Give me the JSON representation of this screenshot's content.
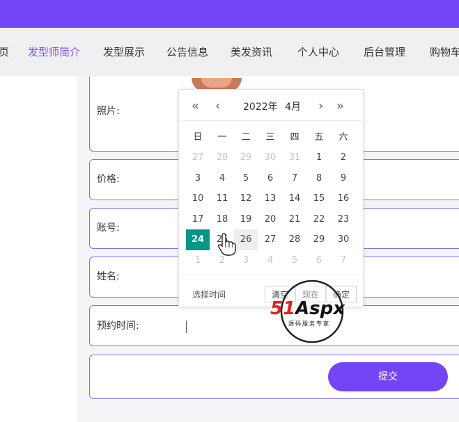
{
  "nav": {
    "items": [
      "页",
      "发型师简介",
      "发型展示",
      "公告信息",
      "美发资讯",
      "个人中心",
      "后台管理",
      "购物车"
    ],
    "active_index": 1
  },
  "form": {
    "photo_label": "照片:",
    "price_label": "价格:",
    "account_label": "账号:",
    "name_label": "姓名:",
    "time_label": "预约时间:",
    "submit_label": "提交"
  },
  "datepicker": {
    "prev_year": "«",
    "prev_month": "‹",
    "next_month": "›",
    "next_year": "»",
    "year_label": "2022年",
    "month_label": "4月",
    "weekdays": [
      "日",
      "一",
      "二",
      "三",
      "四",
      "五",
      "六"
    ],
    "days": [
      [
        "27",
        "28",
        "29",
        "30",
        "31",
        "1",
        "2"
      ],
      [
        "3",
        "4",
        "5",
        "6",
        "7",
        "8",
        "9"
      ],
      [
        "10",
        "11",
        "12",
        "13",
        "14",
        "15",
        "16"
      ],
      [
        "17",
        "18",
        "19",
        "20",
        "21",
        "22",
        "23"
      ],
      [
        "24",
        "25",
        "26",
        "27",
        "28",
        "29",
        "30"
      ],
      [
        "1",
        "2",
        "3",
        "4",
        "5",
        "6",
        "7"
      ]
    ],
    "other_month_cells": [
      [
        0,
        0
      ],
      [
        0,
        1
      ],
      [
        0,
        2
      ],
      [
        0,
        3
      ],
      [
        0,
        4
      ],
      [
        5,
        0
      ],
      [
        5,
        1
      ],
      [
        5,
        2
      ],
      [
        5,
        3
      ],
      [
        5,
        4
      ],
      [
        5,
        5
      ],
      [
        5,
        6
      ]
    ],
    "selected_cell": [
      4,
      0
    ],
    "hover_cell": [
      4,
      2
    ],
    "select_time": "选择时间",
    "clear": "清空",
    "now": "现在",
    "confirm": "确定"
  },
  "watermark": {
    "brand": "51Aspx",
    "tagline": "源码服务专家"
  },
  "colors": {
    "primary": "#7345f6",
    "selected": "#009688",
    "active_nav": "#7a52f1"
  }
}
